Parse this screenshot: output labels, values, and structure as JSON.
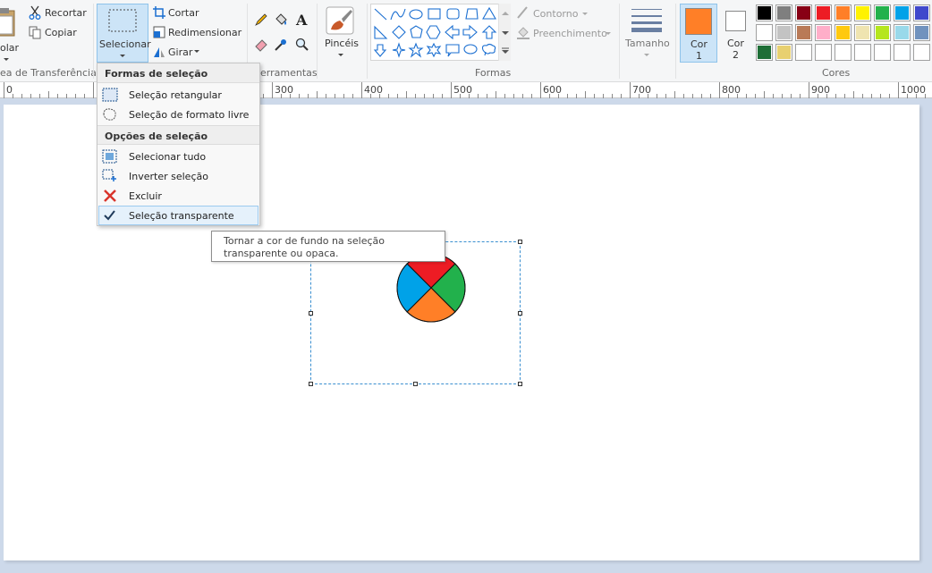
{
  "ribbon": {
    "clipboard": {
      "paste_label": "olar",
      "cut_label": "Recortar",
      "copy_label": "Copiar",
      "group_label": "ea de Transferência"
    },
    "image": {
      "select_label": "Selecionar",
      "crop_label": "Cortar",
      "resize_label": "Redimensionar",
      "rotate_label": "Girar"
    },
    "tools": {
      "group_label": "erramentas",
      "text_glyph": "A"
    },
    "brushes": {
      "label": "Pincéis"
    },
    "shapes": {
      "group_label": "Formas",
      "outline_label": "Contorno",
      "fill_label": "Preenchimento"
    },
    "size": {
      "label": "Tamanho"
    },
    "colors": {
      "color1_label": "Cor",
      "color1_num": "1",
      "color1_value": "#ff7f27",
      "color2_label": "Cor",
      "color2_num": "2",
      "color2_value": "#ffffff",
      "group_label": "Cores",
      "palette_row1": [
        "#000000",
        "#7f7f7f",
        "#880015",
        "#ed1c24",
        "#ff7f27",
        "#fff200",
        "#22b14c",
        "#00a2e8",
        "#3f48cc"
      ],
      "palette_row2": [
        "#ffffff",
        "#c3c3c3",
        "#b97a57",
        "#ffaec9",
        "#ffc90e",
        "#efe4b0",
        "#b5e61d",
        "#99d9ea",
        "#7092be"
      ],
      "palette_row3": [
        "#1e6e36",
        "#e8d070",
        "#ffffff",
        "#ffffff",
        "#ffffff",
        "#ffffff",
        "#ffffff",
        "#ffffff",
        "#ffffff"
      ]
    }
  },
  "ruler": {
    "ticks": [
      "0",
      "300",
      "400",
      "500",
      "600",
      "700",
      "800",
      "900",
      "1000"
    ]
  },
  "menu": {
    "header_shapes": "Formas de seleção",
    "rect_select": "Seleção retangular",
    "free_select": "Seleção de formato livre",
    "header_options": "Opções de seleção",
    "select_all": "Selecionar tudo",
    "invert": "Inverter seleção",
    "delete": "Excluir",
    "transparent": "Seleção transparente"
  },
  "tooltip": {
    "line1": "Tornar a cor de fundo na seleção",
    "line2": "transparente ou opaca."
  },
  "drawing": {
    "colors": [
      "#ed1c24",
      "#22b14c",
      "#ff7f27",
      "#00a2e8"
    ]
  }
}
